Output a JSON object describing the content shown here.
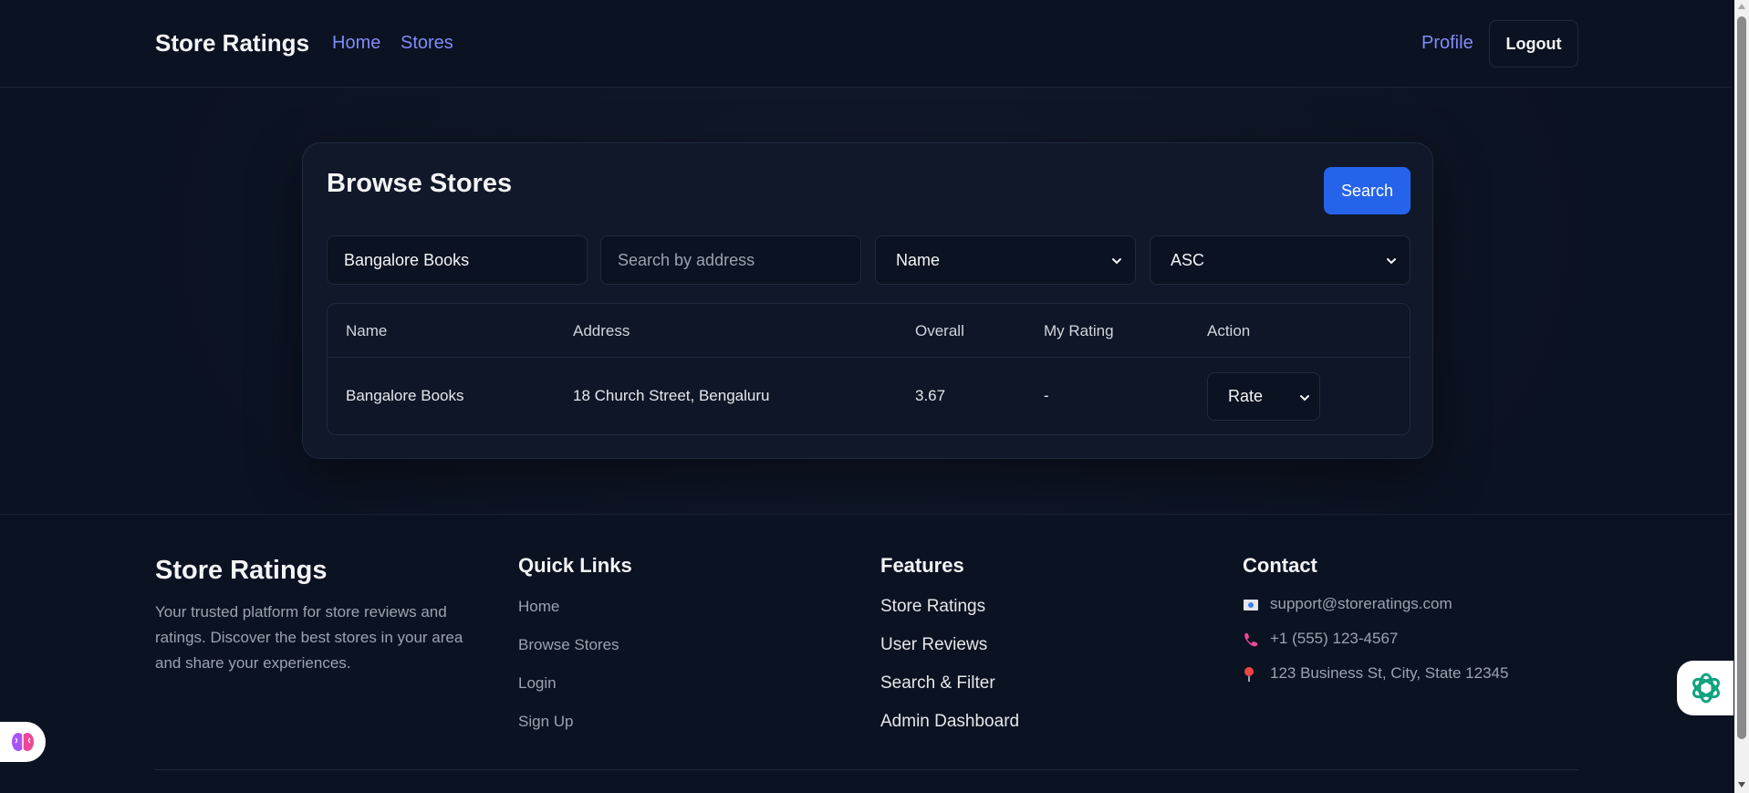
{
  "nav": {
    "brand": "Store Ratings",
    "home": "Home",
    "stores": "Stores",
    "profile": "Profile",
    "logout": "Logout"
  },
  "browse": {
    "title": "Browse Stores",
    "search_button": "Search",
    "name_filter_value": "Bangalore Books",
    "address_placeholder": "Search by address",
    "sort_by_selected": "Name",
    "order_selected": "ASC"
  },
  "table": {
    "headers": [
      "Name",
      "Address",
      "Overall",
      "My Rating",
      "Action"
    ],
    "rows": [
      {
        "name": "Bangalore Books",
        "address": "18 Church Street, Bengaluru",
        "overall": "3.67",
        "my_rating": "-",
        "action_selected": "Rate"
      }
    ]
  },
  "footer": {
    "brand": "Store Ratings",
    "description": "Your trusted platform for store reviews and ratings. Discover the best stores in your area and share your experiences.",
    "quick_links": {
      "title": "Quick Links",
      "items": [
        "Home",
        "Browse Stores",
        "Login",
        "Sign Up"
      ]
    },
    "features": {
      "title": "Features",
      "items": [
        "Store Ratings",
        "User Reviews",
        "Search & Filter",
        "Admin Dashboard"
      ]
    },
    "contact": {
      "title": "Contact",
      "email": "support@storeratings.com",
      "phone": "+1 (555) 123-4567",
      "address": "123 Business St, City, State 12345"
    }
  },
  "colors": {
    "background": "#0b1221",
    "card": "#101829",
    "accent_link": "#818cf8",
    "primary_button": "#2563eb",
    "border": "#1f2a3d"
  },
  "icons": {
    "email": "envelope-icon",
    "phone": "phone-icon",
    "address": "map-pin-icon",
    "assistant": "chatgpt-logo-icon",
    "extension": "brain-icon"
  }
}
